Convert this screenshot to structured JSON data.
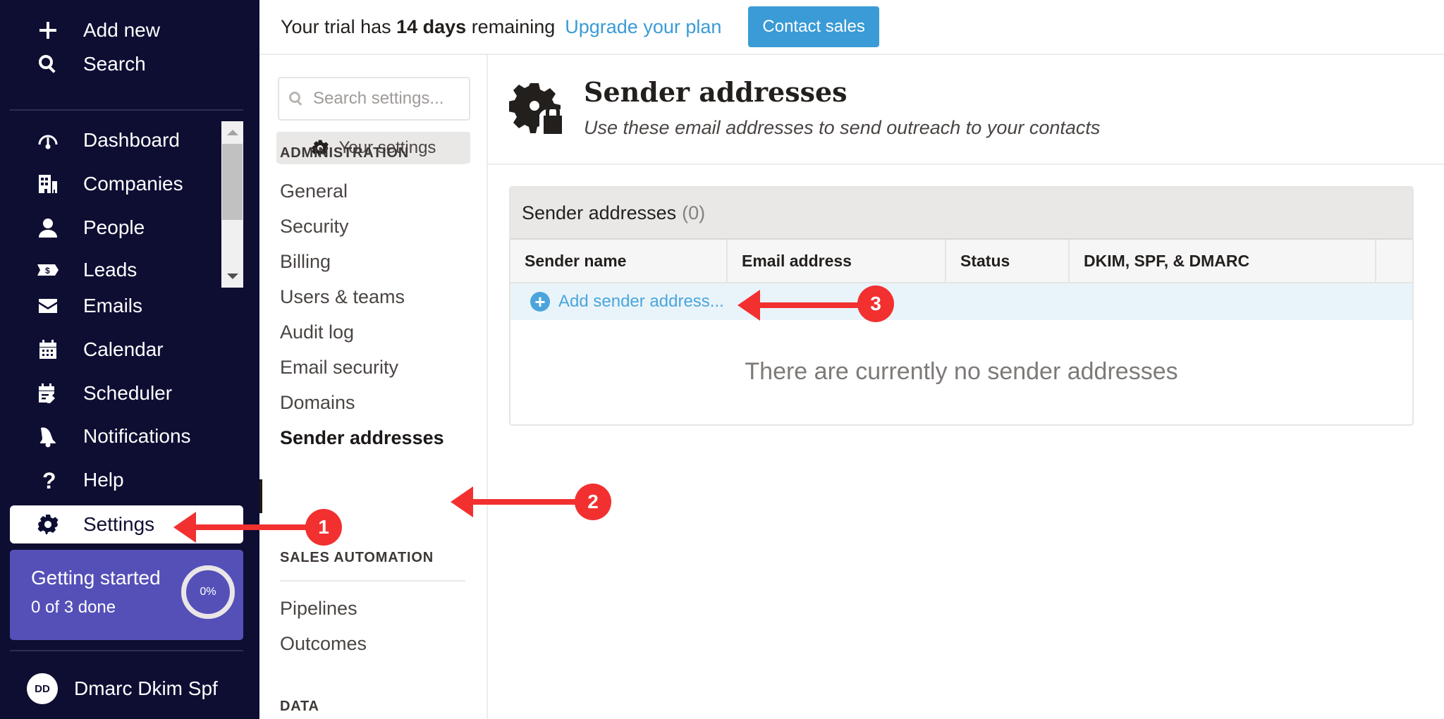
{
  "leftnav": {
    "top_items": [
      {
        "label": "Add new",
        "icon": "plus-icon"
      },
      {
        "label": "Search",
        "icon": "search-icon"
      }
    ],
    "items": [
      {
        "label": "Dashboard",
        "icon": "gauge-icon"
      },
      {
        "label": "Companies",
        "icon": "building-icon"
      },
      {
        "label": "People",
        "icon": "person-icon"
      },
      {
        "label": "Leads",
        "icon": "ticket-dollar-icon"
      },
      {
        "label": "Emails",
        "icon": "envelope-icon"
      },
      {
        "label": "Calendar",
        "icon": "calendar-icon"
      },
      {
        "label": "Scheduler",
        "icon": "calendar-edit-icon"
      },
      {
        "label": "Notifications",
        "icon": "bell-icon"
      },
      {
        "label": "Help",
        "icon": "question-icon"
      },
      {
        "label": "Settings",
        "icon": "gear-icon",
        "active": true
      }
    ],
    "getting_started": {
      "title": "Getting started",
      "subtitle": "0 of 3 done",
      "progress_label": "0%",
      "progress_fraction": 0
    },
    "user": {
      "initials": "DD",
      "name": "Dmarc Dkim Spf"
    }
  },
  "topbar": {
    "trial_prefix": "Your trial has ",
    "trial_days": "14 days",
    "trial_suffix": " remaining",
    "upgrade_link": "Upgrade your plan",
    "contact_button": "Contact sales"
  },
  "settings_nav": {
    "search_placeholder": "Search settings...",
    "your_settings": "Your settings",
    "sections": [
      {
        "heading": "ADMINISTRATION",
        "items": [
          "General",
          "Security",
          "Billing",
          "Users & teams",
          "Audit log",
          "Email security",
          "Domains",
          "Sender addresses"
        ]
      },
      {
        "heading": "SALES AUTOMATION",
        "items": [
          "Pipelines",
          "Outcomes"
        ]
      },
      {
        "heading": "DATA",
        "items": []
      }
    ],
    "active_item": "Sender addresses"
  },
  "main": {
    "title": "Sender addresses",
    "subtitle": "Use these email addresses to send outreach to your contacts",
    "panel": {
      "title": "Sender addresses",
      "count": "(0)",
      "columns": [
        "Sender name",
        "Email address",
        "Status",
        "DKIM, SPF, & DMARC",
        ""
      ],
      "add_label": "Add sender address...",
      "empty_message": "There are currently no sender addresses"
    }
  },
  "annotations": [
    {
      "number": "1",
      "target": "Settings"
    },
    {
      "number": "2",
      "target": "Sender addresses"
    },
    {
      "number": "3",
      "target": "Add sender address..."
    }
  ],
  "colors": {
    "nav_bg": "#0e0e33",
    "accent_blue": "#3a9bd6",
    "getting_started_bg": "#5550b8",
    "annotation_red": "#f23030"
  }
}
